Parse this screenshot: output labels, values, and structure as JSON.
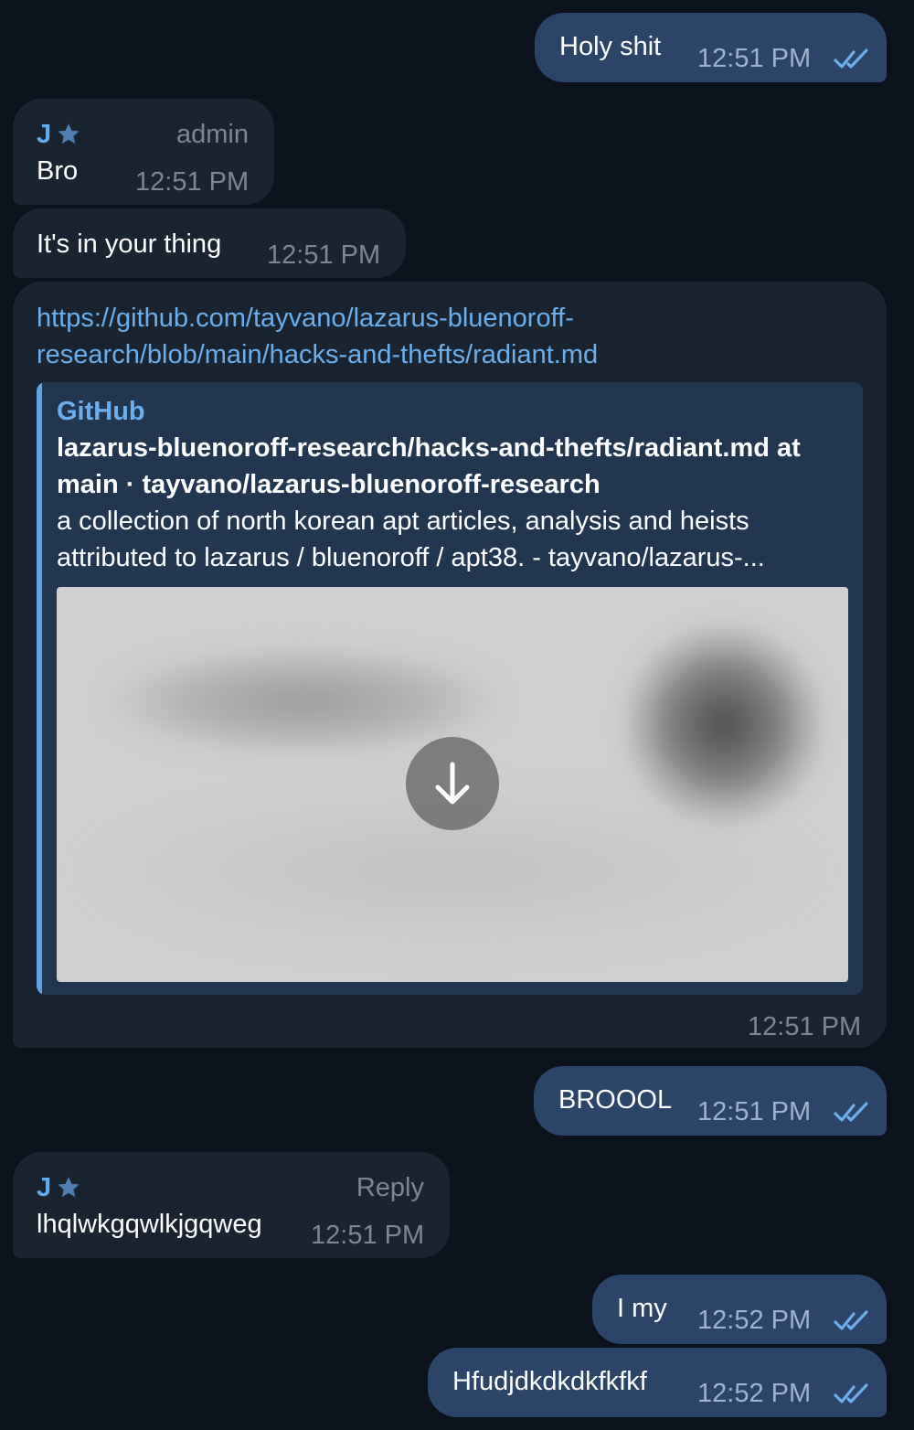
{
  "messages": [
    {
      "text": "Holy shit",
      "time": "12:51 PM"
    },
    {
      "sender": "J",
      "role": "admin",
      "text": "Bro",
      "time": "12:51 PM"
    },
    {
      "text": "It's in your thing",
      "time": "12:51 PM"
    },
    {
      "link": "https://github.com/tayvano/lazarus-bluenoroff-research/blob/main/hacks-and-thefts/radiant.md",
      "preview": {
        "site": "GitHub",
        "title": "lazarus-bluenoroff-research/hacks-and-thefts/radiant.md at main · tayvano/lazarus-bluenoroff-research",
        "description": "a collection of north korean apt articles, analysis and heists attributed to lazarus / bluenoroff / apt38. - tayvano/lazarus-..."
      },
      "time": "12:51 PM"
    },
    {
      "text": "BROOOL",
      "time": "12:51 PM"
    },
    {
      "sender": "J",
      "role": "Reply",
      "text": "lhqlwkgqwlkjgqweg",
      "time": "12:51 PM"
    },
    {
      "text": "I my",
      "time": "12:52 PM"
    },
    {
      "text": "Hfudjdkdkdkfkfkf",
      "time": "12:52 PM"
    }
  ],
  "icons": {
    "read": "double-check-icon",
    "badge": "star-icon",
    "download": "download-arrow-icon"
  },
  "colors": {
    "background": "#0c121b",
    "outgoing": "#2b4468",
    "incoming": "#1a2431",
    "link": "#6caeeb",
    "sender": "#64aaf0"
  }
}
